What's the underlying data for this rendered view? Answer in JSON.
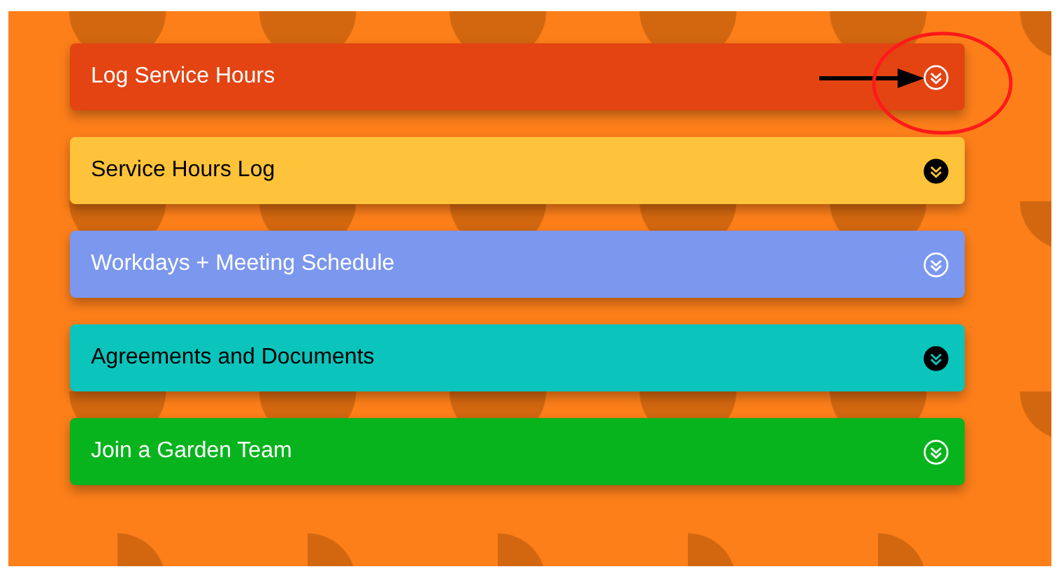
{
  "accordion": [
    {
      "title": "Log Service Hours",
      "color": "#e34412",
      "kind": "light",
      "expanded": false
    },
    {
      "title": "Service Hours Log",
      "color": "#fec33a",
      "kind": "dark",
      "expanded": false
    },
    {
      "title": "Workdays + Meeting Schedule",
      "color": "#7b97ee",
      "kind": "light",
      "expanded": false
    },
    {
      "title": "Agreements and Documents",
      "color": "#0bc4bc",
      "kind": "dark",
      "expanded": false
    },
    {
      "title": "Join a Garden Team",
      "color": "#08b41d",
      "kind": "light",
      "expanded": false
    }
  ]
}
